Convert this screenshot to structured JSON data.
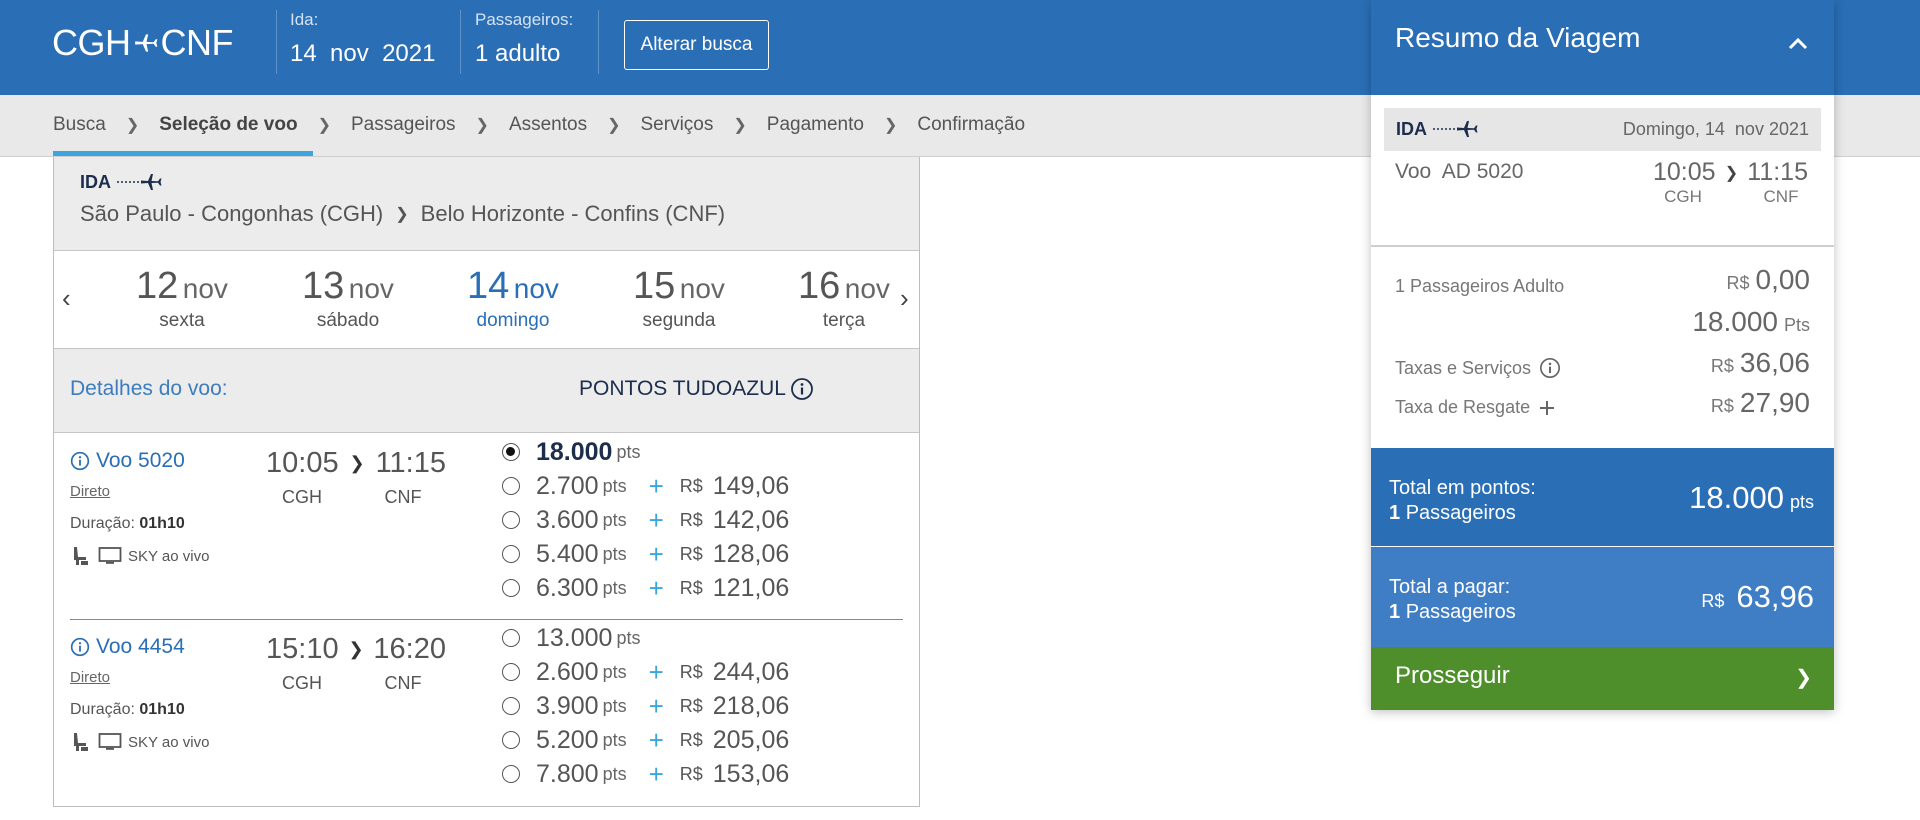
{
  "header": {
    "route_from": "CGH",
    "route_to": "CNF",
    "ida_label": "Ida:",
    "ida_date": "14  nov  2021",
    "passengers_label": "Passageiros:",
    "passengers_value": "1 adulto",
    "alterar_label": "Alterar busca"
  },
  "breadcrumbs": [
    "Busca",
    "Seleção de voo",
    "Passageiros",
    "Assentos",
    "Serviços",
    "Pagamento",
    "Confirmação"
  ],
  "breadcrumb_active": "Seleção de voo",
  "ida": {
    "tag": "IDA",
    "origin": "São Paulo - Congonhas (CGH)",
    "destination": "Belo Horizonte - Confins (CNF)"
  },
  "dates": [
    {
      "day": "12",
      "month": "nov",
      "weekday": "sexta"
    },
    {
      "day": "13",
      "month": "nov",
      "weekday": "sábado"
    },
    {
      "day": "14",
      "month": "nov",
      "weekday": "domingo",
      "selected": true
    },
    {
      "day": "15",
      "month": "nov",
      "weekday": "segunda"
    },
    {
      "day": "16",
      "month": "nov",
      "weekday": "terça"
    }
  ],
  "details": {
    "title": "Detalhes do voo:",
    "pontos_title": "PONTOS TUDOAZUL"
  },
  "flights": [
    {
      "number": "Voo 5020",
      "type": "Direto",
      "duration_label": "Duração:",
      "duration": "01h10",
      "amenity": "SKY ao vivo",
      "depart": "10:05",
      "arrive": "11:15",
      "from": "CGH",
      "to": "CNF",
      "points_only": {
        "points": "18.000",
        "unit": "pts",
        "selected": true
      },
      "options": [
        {
          "points": "2.700",
          "unit": "pts",
          "currency": "R$",
          "money": "149,06"
        },
        {
          "points": "3.600",
          "unit": "pts",
          "currency": "R$",
          "money": "142,06"
        },
        {
          "points": "5.400",
          "unit": "pts",
          "currency": "R$",
          "money": "128,06"
        },
        {
          "points": "6.300",
          "unit": "pts",
          "currency": "R$",
          "money": "121,06"
        }
      ]
    },
    {
      "number": "Voo 4454",
      "type": "Direto",
      "duration_label": "Duração:",
      "duration": "01h10",
      "amenity": "SKY ao vivo",
      "depart": "15:10",
      "arrive": "16:20",
      "from": "CGH",
      "to": "CNF",
      "points_only": {
        "points": "13.000",
        "unit": "pts",
        "selected": false
      },
      "options": [
        {
          "points": "2.600",
          "unit": "pts",
          "currency": "R$",
          "money": "244,06"
        },
        {
          "points": "3.900",
          "unit": "pts",
          "currency": "R$",
          "money": "218,06"
        },
        {
          "points": "5.200",
          "unit": "pts",
          "currency": "R$",
          "money": "205,06"
        },
        {
          "points": "7.800",
          "unit": "pts",
          "currency": "R$",
          "money": "153,06"
        }
      ]
    }
  ],
  "summary": {
    "title": "Resumo da Viagem",
    "ida_tag": "IDA",
    "ida_date": "Domingo, 14  nov 2021",
    "voo": "Voo  AD 5020",
    "depart": "10:05",
    "arrive": "11:15",
    "from": "CGH",
    "to": "CNF",
    "passengers_label": "1 Passageiros Adulto",
    "passengers_currency": "R$",
    "passengers_money": "0,00",
    "points_value": "18.000",
    "points_unit": "Pts",
    "taxas_label": "Taxas e Serviços",
    "taxas_currency": "R$",
    "taxas_value": "36,06",
    "resgate_label": "Taxa de Resgate",
    "resgate_currency": "R$",
    "resgate_value": "27,90",
    "total_points_label": "Total em pontos:",
    "total_points_pass_num": "1",
    "total_points_pass_label": "Passageiros",
    "total_points_value": "18.000",
    "total_points_unit": "pts",
    "total_pay_label": "Total a pagar:",
    "total_pay_pass_num": "1",
    "total_pay_pass_label": "Passageiros",
    "total_pay_currency": "R$",
    "total_pay_value": "63,96",
    "prosseguir_label": "Prosseguir"
  }
}
